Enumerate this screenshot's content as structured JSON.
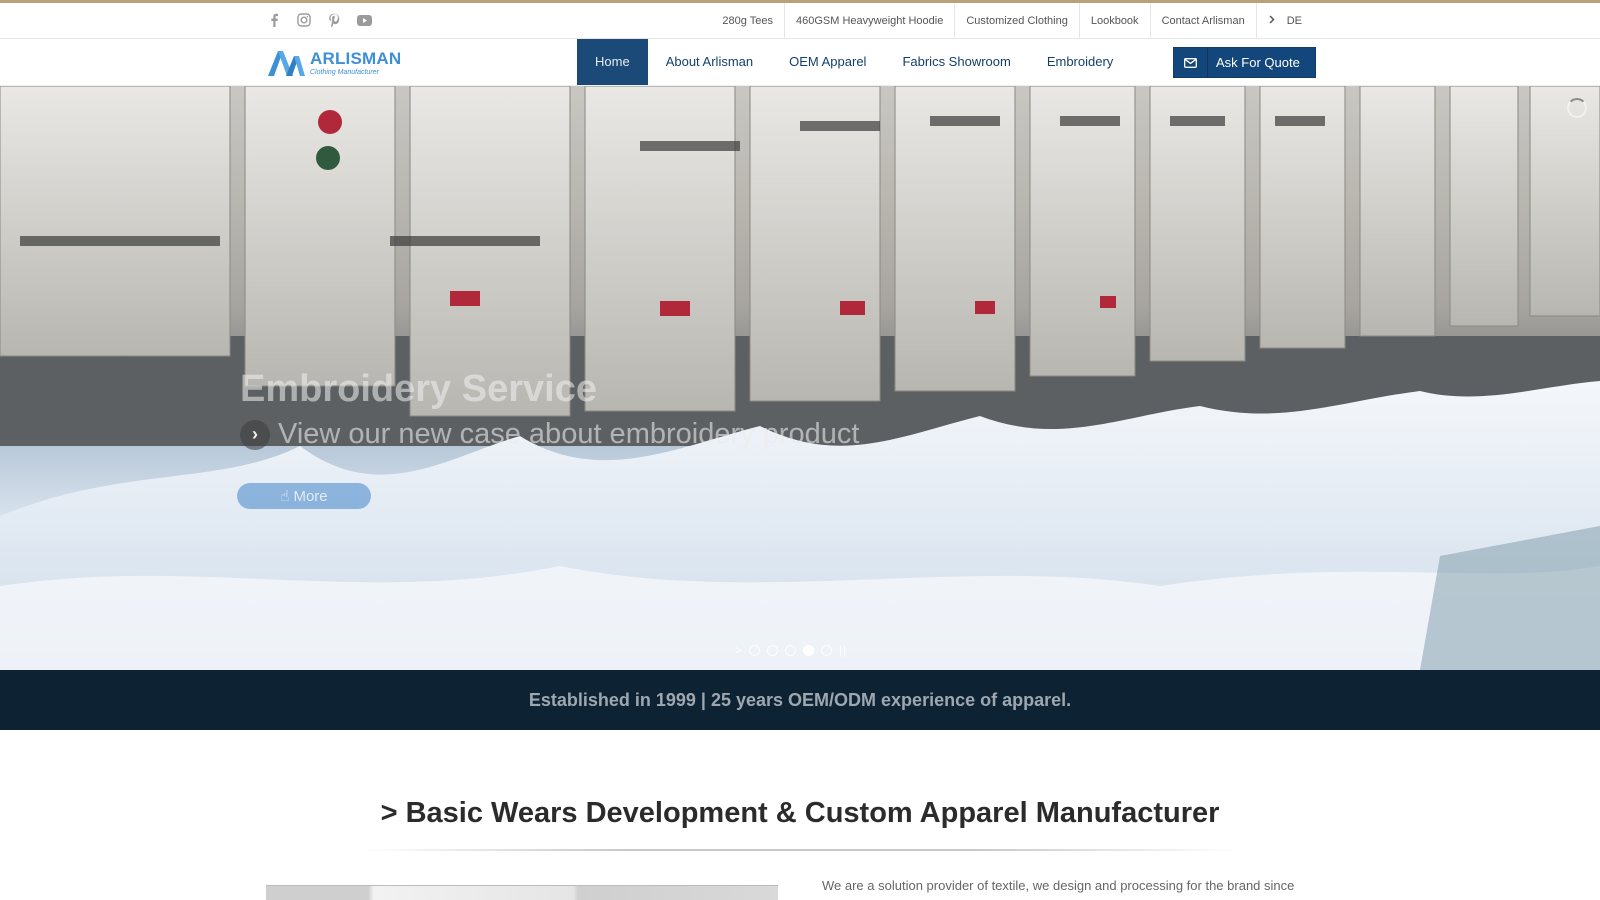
{
  "social": {
    "icons": [
      "facebook-icon",
      "instagram-icon",
      "pinterest-icon",
      "youtube-icon"
    ]
  },
  "top_links": [
    "280g Tees",
    "460GSM Heavyweight Hoodie",
    "Customized Clothing",
    "Lookbook",
    "Contact Arlisman"
  ],
  "language": {
    "label": "DE"
  },
  "logo": {
    "name": "ARLISMAN",
    "tagline": "Clothing Manufacturer"
  },
  "nav": {
    "items": [
      {
        "label": "Home",
        "active": true
      },
      {
        "label": "About Arlisman",
        "active": false
      },
      {
        "label": "OEM Apparel",
        "active": false
      },
      {
        "label": "Fabrics Showroom",
        "active": false
      },
      {
        "label": "Embroidery",
        "active": false
      }
    ],
    "quote_button": "Ask For Quote"
  },
  "hero": {
    "title": "Embroidery Service",
    "subtitle": "View our new case about embroidery product",
    "button": "More",
    "slides": 5,
    "active_slide": 4
  },
  "banner": {
    "text": "Established in 1999 | 25 years OEM/ODM experience of apparel."
  },
  "section": {
    "title": "> Basic Wears Development & Custom Apparel Manufacturer",
    "intro": "We are a solution provider of textile, we design and processing for the brand since"
  },
  "colors": {
    "accent": "#1b4a79",
    "top_border": "#b9a27a",
    "banner_bg": "#0d2233",
    "logo_blue": "#3d8fd6"
  }
}
